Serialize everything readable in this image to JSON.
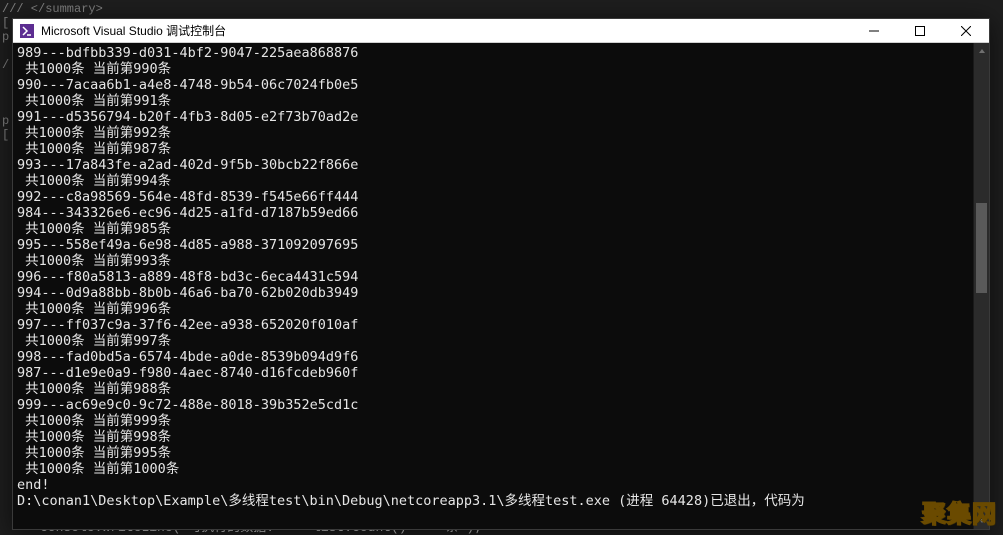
{
  "bg_editor": {
    "top_lines": [
      "/// </summary>",
      "[",
      "p ",
      " ",
      "/ ",
      " ",
      " ",
      " ",
      "p ",
      "["
    ],
    "bottom_line": "Console.WriteLine(\"可执行的数据: \" + list.Count() + \" 条\");"
  },
  "window": {
    "title": "Microsoft Visual Studio 调试控制台"
  },
  "terminal_lines": [
    "989---bdfbb339-d031-4bf2-9047-225aea868876",
    " 共1000条 当前第990条",
    "990---7acaa6b1-a4e8-4748-9b54-06c7024fb0e5",
    " 共1000条 当前第991条",
    "991---d5356794-b20f-4fb3-8d05-e2f73b70ad2e",
    " 共1000条 当前第992条",
    " 共1000条 当前第987条",
    "993---17a843fe-a2ad-402d-9f5b-30bcb22f866e",
    " 共1000条 当前第994条",
    "992---c8a98569-564e-48fd-8539-f545e66ff444",
    "984---343326e6-ec96-4d25-a1fd-d7187b59ed66",
    " 共1000条 当前第985条",
    "995---558ef49a-6e98-4d85-a988-371092097695",
    " 共1000条 当前第993条",
    "996---f80a5813-a889-48f8-bd3c-6eca4431c594",
    "994---0d9a88bb-8b0b-46a6-ba70-62b020db3949",
    " 共1000条 当前第996条",
    "997---ff037c9a-37f6-42ee-a938-652020f010af",
    " 共1000条 当前第997条",
    "998---fad0bd5a-6574-4bde-a0de-8539b094d9f6",
    "987---d1e9e0a9-f980-4aec-8740-d16fcdeb960f",
    " 共1000条 当前第988条",
    "999---ac69e9c0-9c72-488e-8018-39b352e5cd1c",
    " 共1000条 当前第999条",
    " 共1000条 当前第998条",
    " 共1000条 当前第995条",
    " 共1000条 当前第1000条",
    "end!",
    "",
    "D:\\conan1\\Desktop\\Example\\多线程test\\bin\\Debug\\netcoreapp3.1\\多线程test.exe (进程 64428)已退出，代码为"
  ],
  "watermark": "聚集网"
}
